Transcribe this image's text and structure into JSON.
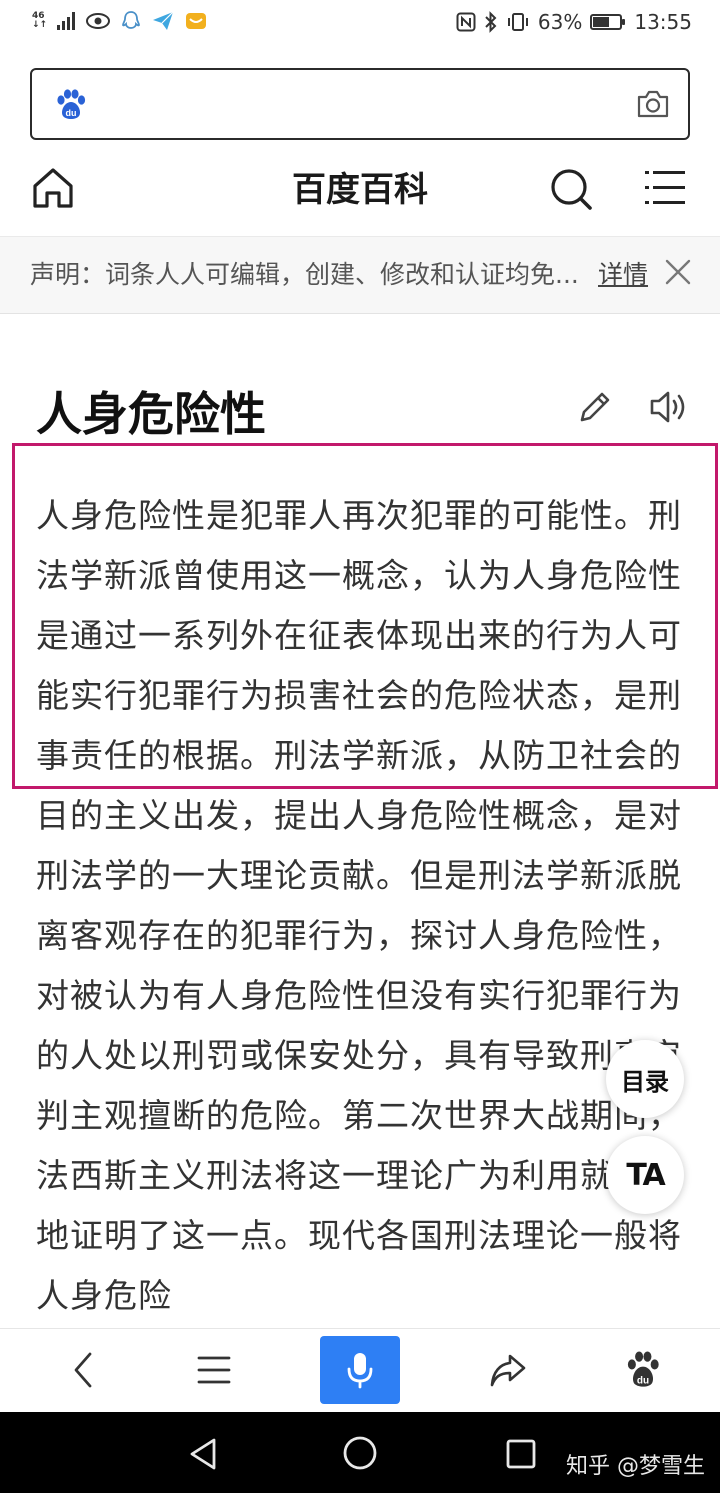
{
  "status_bar": {
    "network": "46",
    "battery": "63%",
    "battery_level": 0.63,
    "time": "13:55"
  },
  "search": {
    "placeholder": ""
  },
  "header": {
    "title": "百度百科"
  },
  "notice": {
    "text": "声明：词条人人可编辑，创建、修改和认证均免...",
    "link": "详情"
  },
  "article": {
    "title": "人身危险性",
    "body": "人身危险性是犯罪人再次犯罪的可能性。刑法学新派曾使用这一概念，认为人身危险性是通过一系列外在征表体现出来的行为人可能实行犯罪行为损害社会的危险状态，是刑事责任的根据。刑法学新派，从防卫社会的目的主义出发，提出人身危险性概念，是对刑法学的一大理论贡献。但是刑法学新派脱离客观存在的犯罪行为，探讨人身危险性，对被认为有人身危险性但没有实行犯罪行为的人处以刑罚或保安处分，具有导致刑事审判主观擅断的危险。第二次世界大战期间，法西斯主义刑法将这一理论广为利用就充分地证明了这一点。现代各国刑法理论一般将人身危险"
  },
  "floating": {
    "toc": "目录",
    "font_size": "TA"
  },
  "watermark": "知乎 @梦雪生",
  "colors": {
    "highlight": "#c2186b",
    "voice_button": "#2e7ff4",
    "baidu_blue": "#2a62d6"
  },
  "icons": {
    "search_logo": "baidu-paw-icon",
    "camera": "camera-icon",
    "home": "home-icon",
    "search": "search-icon",
    "menu": "menu-icon",
    "close": "close-icon",
    "edit": "pencil-icon",
    "audio": "speaker-icon",
    "back": "chevron-left-icon",
    "list": "list-icon",
    "voice": "microphone-icon",
    "share": "share-icon",
    "baidu": "baidu-paw-icon"
  }
}
